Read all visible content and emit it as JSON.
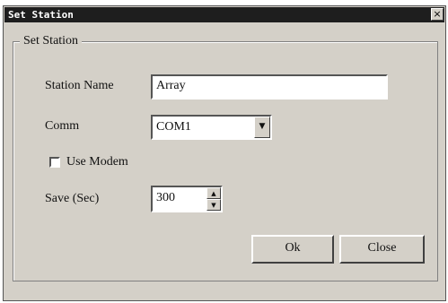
{
  "window": {
    "title": "Set Station",
    "close_glyph": "×"
  },
  "group": {
    "label": "Set Station"
  },
  "station_name": {
    "label": "Station Name",
    "value": "Array"
  },
  "comm": {
    "label": "Comm",
    "selected": "COM1",
    "arrow_glyph": "▼"
  },
  "use_modem": {
    "label": "Use Modem",
    "checked": false
  },
  "save": {
    "label": "Save (Sec)",
    "value": "300",
    "up_glyph": "▲",
    "down_glyph": "▼"
  },
  "buttons": {
    "ok_label": "Ok",
    "close_label": "Close"
  },
  "icons": {
    "close": "close-icon",
    "dropdown": "chevron-down-icon",
    "spin_up": "chevron-up-icon",
    "spin_down": "chevron-down-icon"
  }
}
